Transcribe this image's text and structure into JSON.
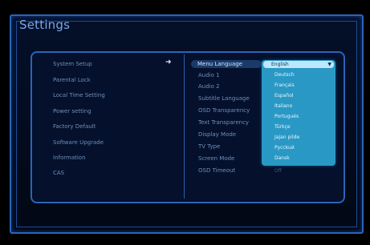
{
  "title": "Settings",
  "left_menu": [
    "System Setup",
    "Parental Lock",
    "Local Time Setting",
    "Power setting",
    "Factory Default",
    "Software Upgrade",
    "Information",
    "CAS"
  ],
  "right_menu": [
    "Menu Language",
    "Audio 1",
    "Audio 2",
    "Subtitle Language",
    "OSD Transparency",
    "Text Transparency",
    "Display Mode",
    "TV Type",
    "Screen Mode",
    "OSD Timeout"
  ],
  "dropdown": {
    "current": "English",
    "options": [
      "Deutsch",
      "Français",
      "Español",
      "Italiano",
      "Portugués",
      "Türkçe",
      "Jajan pilde",
      "Pycckuй",
      "Dansk"
    ],
    "after": "Off"
  },
  "icons": {
    "arrow": "right-arrow-icon",
    "chevron": "chevron-down-icon"
  }
}
